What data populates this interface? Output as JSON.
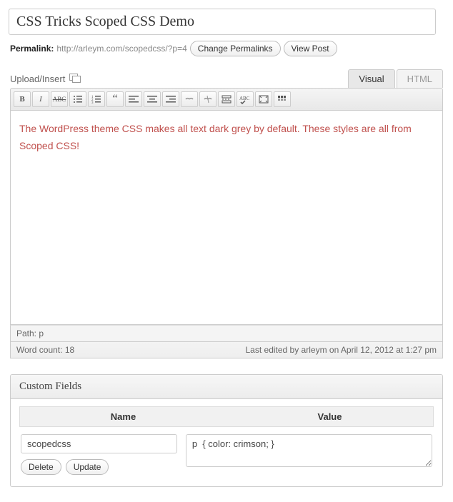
{
  "title": "CSS Tricks Scoped CSS Demo",
  "permalink": {
    "label": "Permalink:",
    "url": "http://arleym.com/scopedcss/?p=4",
    "change_btn": "Change Permalinks",
    "view_btn": "View Post"
  },
  "upload_insert": "Upload/Insert",
  "tabs": {
    "visual": "Visual",
    "html": "HTML"
  },
  "content": "The WordPress theme CSS makes all text dark grey by default. These styles are all from Scoped CSS!",
  "status": {
    "path_label": "Path:",
    "path_value": "p",
    "word_count_label": "Word count:",
    "word_count": "18",
    "last_edited": "Last edited by arleym on April 12, 2012 at 1:27 pm"
  },
  "custom_fields": {
    "title": "Custom Fields",
    "name_header": "Name",
    "value_header": "Value",
    "row": {
      "name": "scopedcss",
      "value": "p  { color: crimson; }"
    },
    "delete_btn": "Delete",
    "update_btn": "Update"
  }
}
